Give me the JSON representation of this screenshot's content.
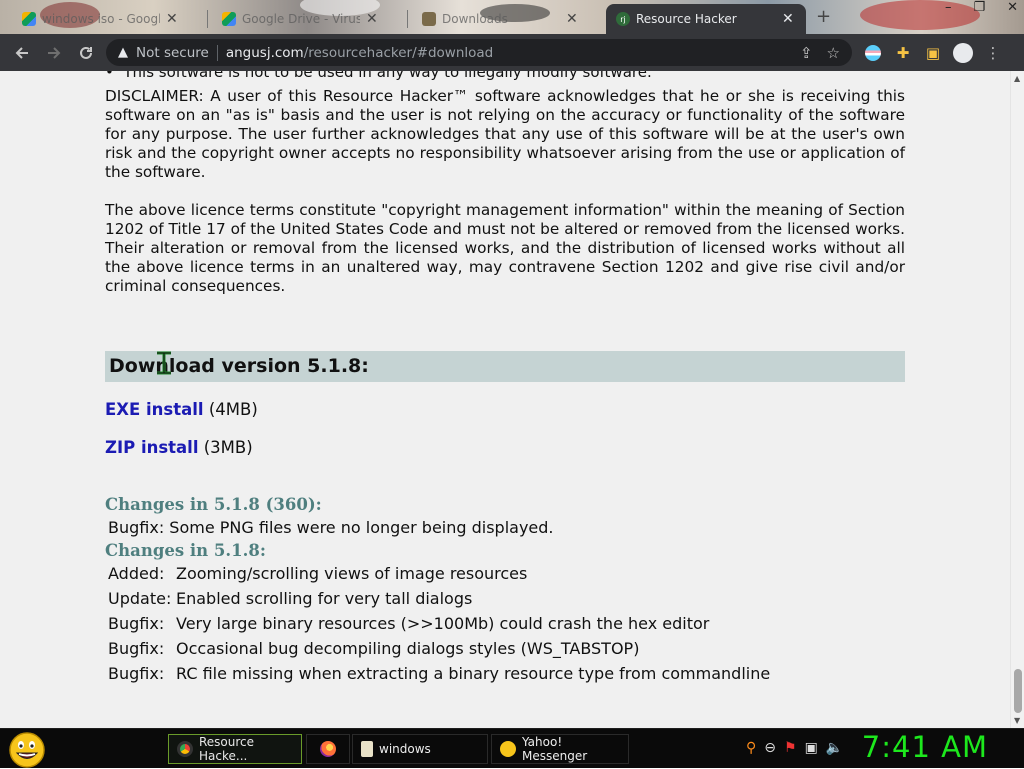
{
  "browser": {
    "tabs": [
      {
        "title": "windows iso - Google D",
        "favicon": "google-drive-icon",
        "active": false
      },
      {
        "title": "Google Drive - Virus sca",
        "favicon": "google-drive-icon",
        "active": false
      },
      {
        "title": "Downloads",
        "favicon": "download-icon",
        "active": false
      },
      {
        "title": "Resource Hacker",
        "favicon": "resource-hacker-icon",
        "active": true
      }
    ],
    "new_tab_label": "+",
    "window_controls": [
      "–",
      "❐",
      "✕"
    ],
    "address": {
      "security_label": "Not secure",
      "host": "angusj.com",
      "path": "/resourcehacker/#download"
    }
  },
  "page": {
    "partial_bullet": "This software is not to be used in any way to illegally modify software.",
    "disclaimer": "DISCLAIMER: A user of this Resource Hacker™ software acknowledges that he or she is receiving this software on an \"as is\" basis and the user is not relying on the accuracy or functionality of the software for any purpose. The user further acknowledges that any use of this software will be at the user's own risk and the copyright owner accepts no responsibility whatsoever arising from the use or application of the software.",
    "licence": "The above licence terms constitute \"copyright management information\" within the meaning of Section 1202 of Title 17 of the United States Code and must not be altered or removed from the licensed works. Their alteration or removal from the licensed works, and the distribution of licensed works without all the above licence terms in an unaltered way, may contravene Section 1202 and give rise civil and/or criminal consequences.",
    "download_header": "Download version 5.1.8:",
    "exe_link": "EXE install",
    "exe_size": "(4MB)",
    "zip_link": "ZIP install",
    "zip_size": "(3MB)",
    "changes_a_header": "Changes in 5.1.8 (360):",
    "changes_a_line": "Bugfix: Some PNG files were no longer being displayed.",
    "changes_b_header": "Changes in 5.1.8:",
    "changes_b": [
      {
        "kind": "Added:",
        "text": "Zooming/scrolling views of image resources"
      },
      {
        "kind": "Update:",
        "text": "Enabled scrolling for very tall dialogs"
      },
      {
        "kind": "Bugfix:",
        "text": "Very large binary resources (>>100Mb) could crash the hex editor"
      },
      {
        "kind": "Bugfix:",
        "text": "Occasional bug decompiling dialogs styles (WS_TABSTOP)"
      },
      {
        "kind": "Bugfix:",
        "text": "RC file missing when extracting a binary resource type from commandline"
      }
    ]
  },
  "taskbar": {
    "tasks": [
      {
        "label": "Resource Hacke...",
        "icon": "chrome-icon",
        "active": true
      },
      {
        "label": "",
        "icon": "firefox-icon",
        "active": false
      },
      {
        "label": "windows",
        "icon": "folder-icon",
        "active": false
      },
      {
        "label": "Yahoo! Messenger",
        "icon": "yahoo-messenger-icon",
        "active": false
      }
    ],
    "clock": "7:41 AM"
  },
  "colors": {
    "download_header_bg": "#c5d3d3",
    "link": "#1b1bb3",
    "changes_header": "#4f7f7f",
    "clock": "#1de81d"
  }
}
